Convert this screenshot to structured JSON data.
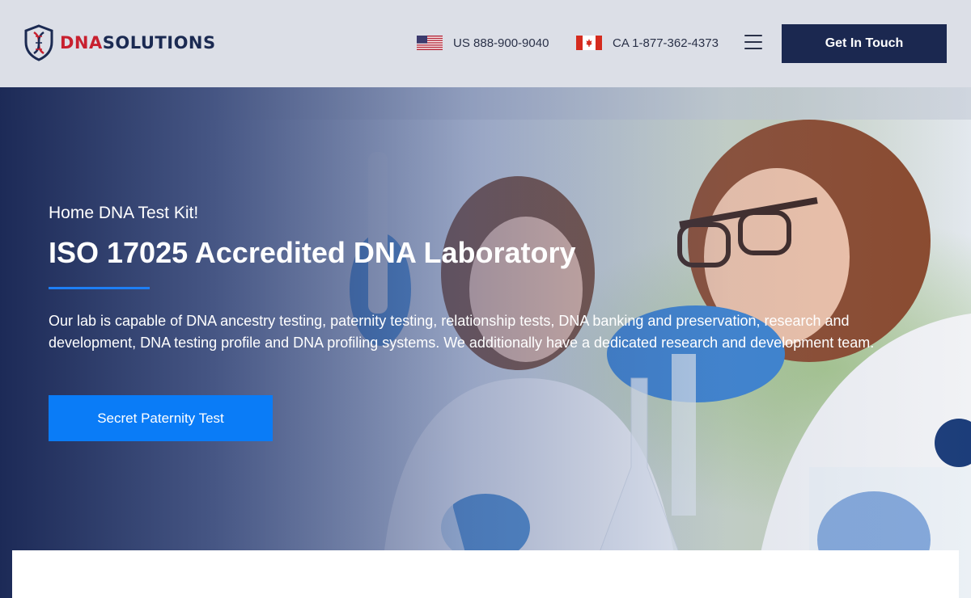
{
  "header": {
    "logo": {
      "dna": "DNA",
      "solutions": "SOLUTIONS"
    },
    "phones": [
      {
        "country": "US",
        "flag": "us-flag-icon",
        "text": "US 888-900-9040"
      },
      {
        "country": "CA",
        "flag": "canada-flag-icon",
        "text": "CA 1-877-362-4373"
      }
    ],
    "menu_icon": "hamburger-menu-icon",
    "cta_label": "Get In Touch"
  },
  "hero": {
    "eyebrow": "Home DNA Test Kit!",
    "title": "ISO 17025 Accredited DNA Laboratory",
    "description": "Our lab is capable of DNA ancestry testing, paternity testing, relationship tests, DNA banking and preservation, research and development, DNA testing profile and DNA profiling systems. We additionally have a dedicated research and development team.",
    "cta_label": "Secret Paternity Test"
  },
  "colors": {
    "brand_red": "#c8202f",
    "brand_navy": "#1b2850",
    "accent_blue": "#0a7cf7",
    "header_bg": "#dcdfe7"
  }
}
